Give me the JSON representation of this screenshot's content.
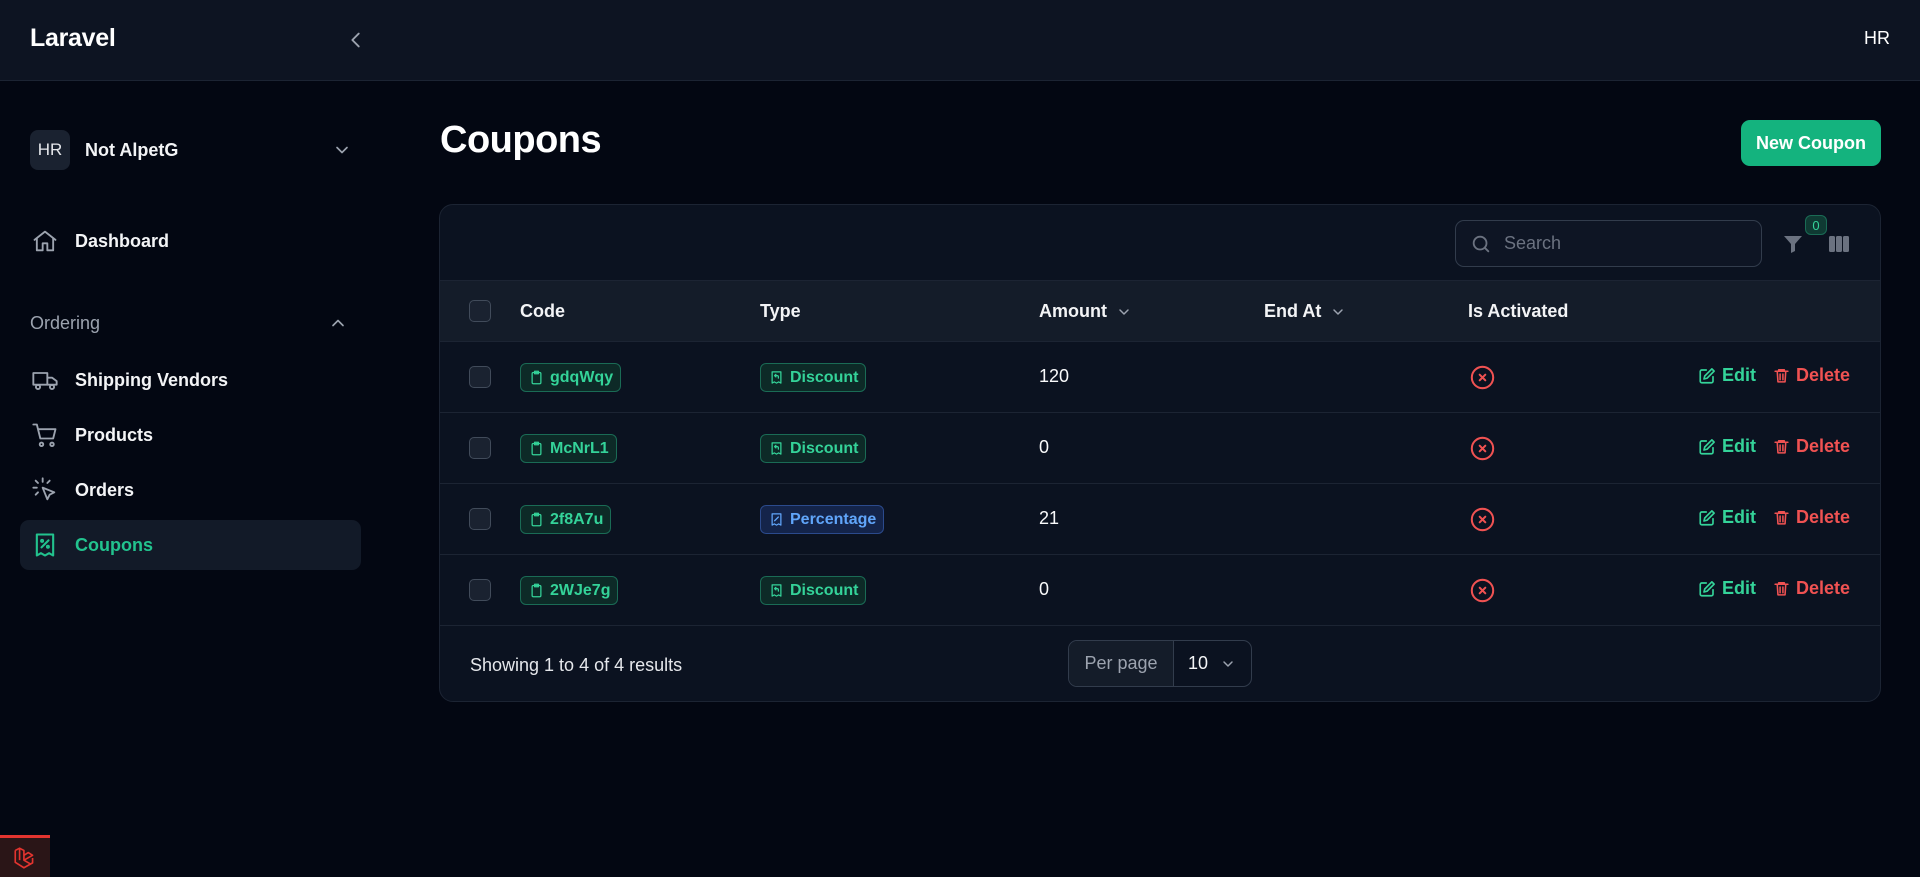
{
  "app": {
    "brand": "Laravel",
    "user_initials": "HR"
  },
  "tenant": {
    "initials": "HR",
    "name": "Not AlpetG"
  },
  "sidebar": {
    "dashboard_label": "Dashboard",
    "group_label": "Ordering",
    "items": [
      {
        "label": "Shipping Vendors",
        "icon": "truck-icon"
      },
      {
        "label": "Products",
        "icon": "shopping-cart-icon"
      },
      {
        "label": "Orders",
        "icon": "cursor-click-icon"
      },
      {
        "label": "Coupons",
        "icon": "receipt-percent-icon",
        "active": true
      }
    ]
  },
  "page": {
    "title": "Coupons",
    "new_button": "New Coupon"
  },
  "toolbar": {
    "search_placeholder": "Search",
    "filter_count": "0"
  },
  "table": {
    "columns": {
      "code": "Code",
      "type": "Type",
      "amount": "Amount",
      "end_at": "End At",
      "is_activated": "Is Activated"
    },
    "actions": {
      "edit": "Edit",
      "delete": "Delete"
    },
    "rows": [
      {
        "code": "gdqWqy",
        "type": "Discount",
        "amount": "120",
        "end_at": "",
        "activated": false
      },
      {
        "code": "McNrL1",
        "type": "Discount",
        "amount": "0",
        "end_at": "",
        "activated": false
      },
      {
        "code": "2f8A7u",
        "type": "Percentage",
        "amount": "21",
        "end_at": "",
        "activated": false
      },
      {
        "code": "2WJe7g",
        "type": "Discount",
        "amount": "0",
        "end_at": "",
        "activated": false
      }
    ]
  },
  "pagination": {
    "summary": "Showing 1 to 4 of 4 results",
    "per_page_label": "Per page",
    "per_page_value": "10"
  },
  "colors": {
    "accent": "#14b37e",
    "danger": "#f05252",
    "info": "#60a5fa",
    "background": "#030712"
  }
}
